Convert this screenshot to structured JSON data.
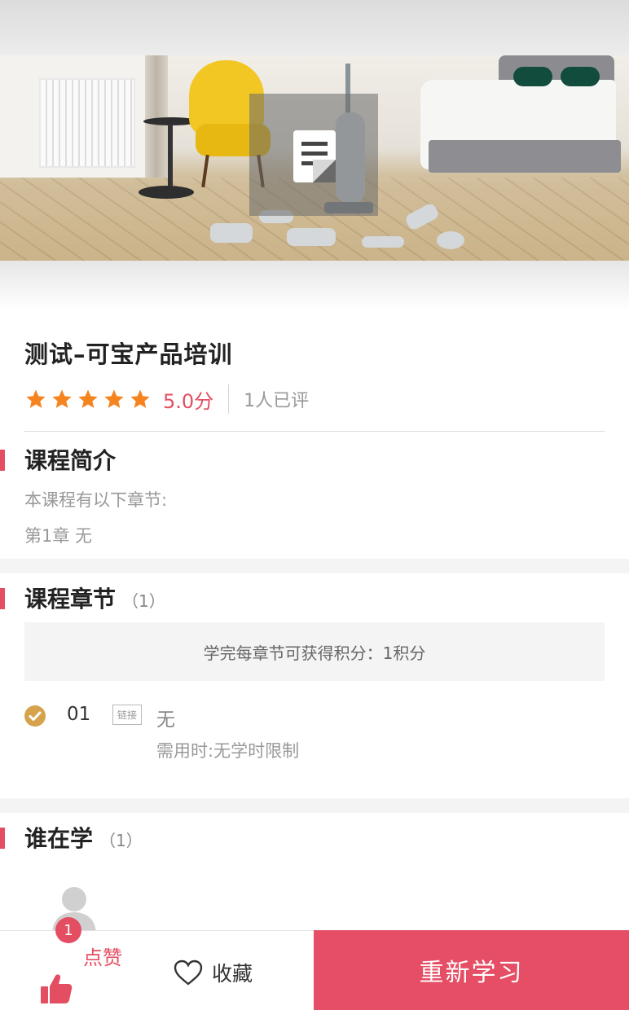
{
  "course": {
    "title": "测试–可宝产品培训",
    "rating": 5.0,
    "score_text": "5.0分",
    "rating_count_text": "1人已评",
    "stars": 5
  },
  "intro": {
    "heading": "课程简介",
    "line1": "本课程有以下章节:",
    "line2": "第1章 无"
  },
  "chapters": {
    "heading": "课程章节",
    "count_text": "（1）",
    "points_text": "学完每章节可获得积分：1积分",
    "items": [
      {
        "number": "01",
        "type": "链接",
        "title": "无",
        "time": "需用时:无学时限制"
      }
    ]
  },
  "learners": {
    "heading": "谁在学",
    "count_text": "（1）"
  },
  "bottom_bar": {
    "like_badge": "1",
    "like_label": "点赞",
    "favorite_label": "收藏",
    "relearn_label": "重新学习"
  },
  "colors": {
    "accent": "#e44e62",
    "star": "#f5841f",
    "check": "#d7a24c",
    "primary_button": "#e54e65"
  },
  "icons": {
    "cover_document": "document-icon",
    "star": "star-icon",
    "check": "check-circle-icon",
    "like": "thumbs-up-icon",
    "favorite": "heart-outline-icon",
    "avatar": "default-user-avatar-icon"
  }
}
